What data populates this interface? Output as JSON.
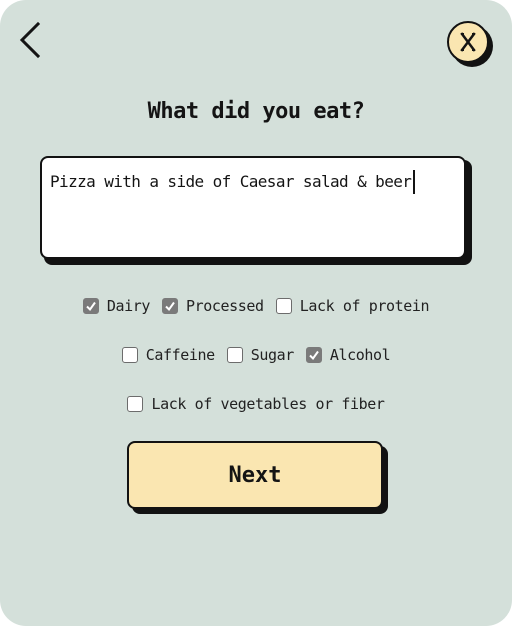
{
  "header": {
    "back_icon": "chevron-left-icon",
    "close_icon": "close-icon",
    "close_button_color": "#fae6b1"
  },
  "question": {
    "title": "What did you eat?"
  },
  "food_input": {
    "value": "Pizza with a side of Caesar salad & beer"
  },
  "tags": {
    "rows": [
      [
        {
          "label": "Dairy",
          "checked": true
        },
        {
          "label": "Processed",
          "checked": true
        },
        {
          "label": "Lack of protein",
          "checked": false
        }
      ],
      [
        {
          "label": "Caffeine",
          "checked": false
        },
        {
          "label": "Sugar",
          "checked": false
        },
        {
          "label": "Alcohol",
          "checked": true
        }
      ],
      [
        {
          "label": "Lack of vegetables or fiber",
          "checked": false
        }
      ]
    ]
  },
  "actions": {
    "next_label": "Next",
    "next_color": "#fae6b1"
  },
  "colors": {
    "background": "#d4e0da",
    "border": "#121212",
    "checkbox_checked": "#7a7a7a"
  }
}
